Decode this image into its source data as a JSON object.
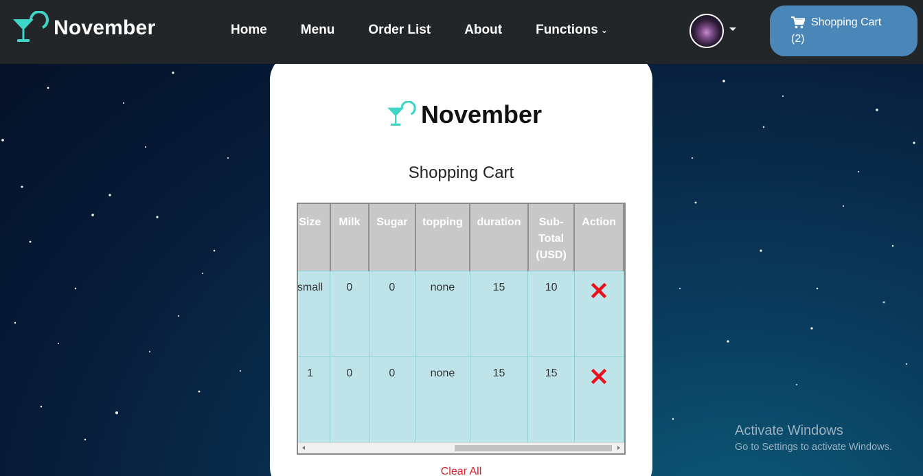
{
  "brand": {
    "name": "November"
  },
  "nav": {
    "links": [
      "Home",
      "Menu",
      "Order List",
      "About",
      "Functions"
    ]
  },
  "cart_button": {
    "label": "Shopping Cart",
    "count": "(2)"
  },
  "card": {
    "brand_name": "November",
    "title": "Shopping Cart"
  },
  "table": {
    "headers": [
      "Size",
      "Milk",
      "Sugar",
      "topping",
      "duration",
      "Sub-Total (USD)",
      "Action"
    ],
    "rows": [
      [
        "small",
        "0",
        "0",
        "none",
        "15",
        "10"
      ],
      [
        "1",
        "0",
        "0",
        "none",
        "15",
        "15"
      ]
    ]
  },
  "clear_all": "Clear All",
  "watermark": {
    "title": "Activate Windows",
    "subtitle": "Go to Settings to activate Windows."
  },
  "colors": {
    "navbar": "#232628",
    "accent_teal": "#3fd6c8",
    "cart_button": "#4a86b8",
    "table_header": "#c8c8c8",
    "table_cell": "#bee4ea",
    "remove_red": "#e8101a"
  },
  "icons": [
    "cocktail-logo-icon",
    "chevron-down-icon",
    "cart-icon",
    "remove-x-icon"
  ]
}
